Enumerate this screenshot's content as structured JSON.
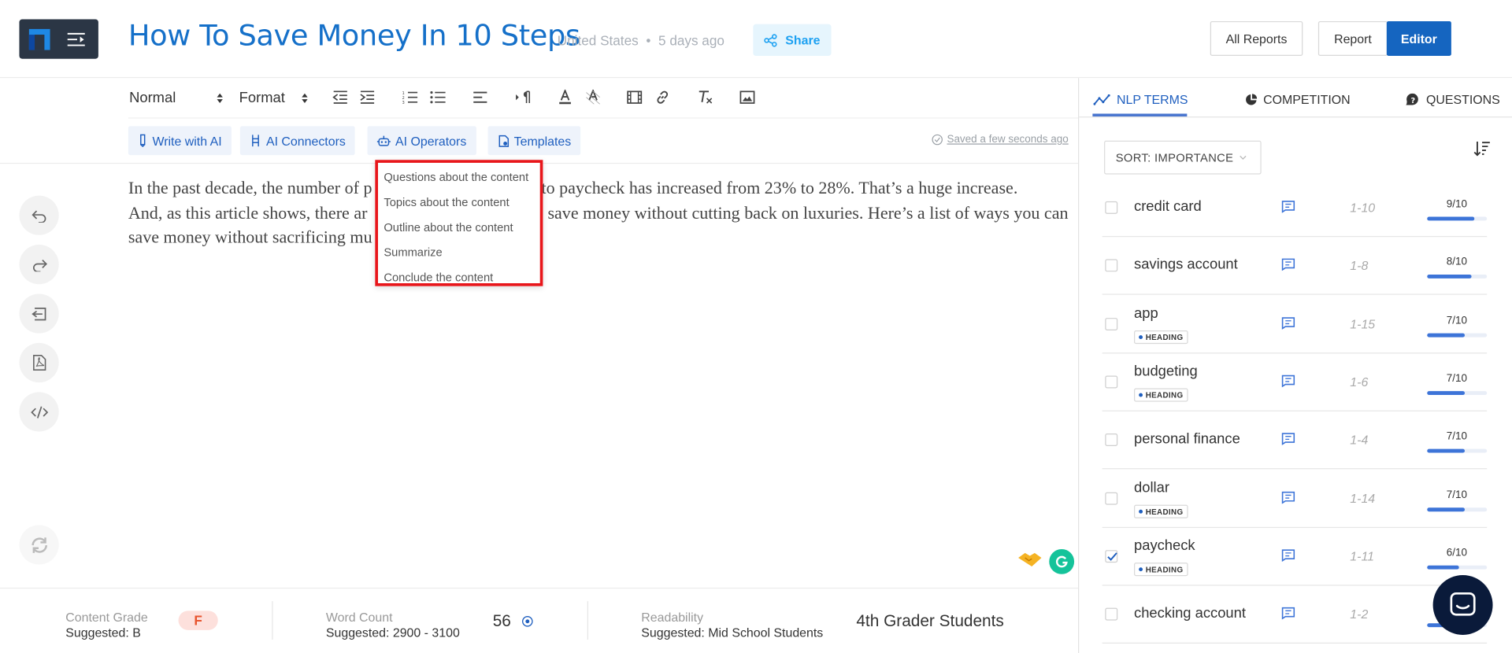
{
  "header": {
    "title": "How To Save Money In 10 Steps",
    "country": "United States",
    "age": "5 days ago",
    "meta_separator": "•",
    "share_label": "Share",
    "all_reports_label": "All Reports",
    "report_label": "Report",
    "editor_label": "Editor"
  },
  "toolbar": {
    "style_select": "Normal",
    "format_select": "Format"
  },
  "ai_bar": {
    "write_with_ai": "Write with AI",
    "ai_connectors": "AI Connectors",
    "ai_operators": "AI Operators",
    "templates": "Templates",
    "saved_status": "Saved a few seconds ago"
  },
  "editor": {
    "line1": "In the past decade, the number of people living paycheck to paycheck has increased from 23% to 28%. That’s a huge increase.",
    "line2": "And, as this article shows, there are many ways you can save money without cutting back on luxuries. Here’s a list of ways you can",
    "line3": "save money without sacrificing much.",
    "l1a": "In the past decade, the number of p",
    "l1b": "k to paycheck has increased from 23% to 28%. That’s a huge increase.",
    "l2a": "And, as this article shows, there ar",
    "l2b": "save money without cutting back on luxuries. Here’s a list of ways you can",
    "l3a": "save money without sacrificing mu"
  },
  "ai_operators_menu": [
    {
      "label": "Questions about the content"
    },
    {
      "label": "Topics about the content"
    },
    {
      "label": "Outline about the content"
    },
    {
      "label": "Summarize"
    },
    {
      "label": "Conclude the content"
    }
  ],
  "footer": {
    "content_grade_label": "Content Grade",
    "content_grade_suggested": "Suggested: B",
    "content_grade_value": "F",
    "word_count_label": "Word Count",
    "word_count_suggested": "Suggested: 2900 - 3100",
    "word_count_value": "56",
    "readability_label": "Readability",
    "readability_suggested": "Suggested: Mid School Students",
    "readability_value": "4th Grader Students"
  },
  "panel": {
    "tabs": [
      "NLP TERMS",
      "COMPETITION",
      "QUESTIONS"
    ],
    "sort_label": "SORT: IMPORTANCE",
    "heading_badge": "HEADING",
    "terms": [
      {
        "term": "credit card",
        "range": "1-10",
        "score": "9/10",
        "score_value": 9,
        "heading": false,
        "checked": false
      },
      {
        "term": "savings account",
        "range": "1-8",
        "score": "8/10",
        "score_value": 8,
        "heading": false,
        "checked": false
      },
      {
        "term": "app",
        "range": "1-15",
        "score": "7/10",
        "score_value": 7,
        "heading": true,
        "checked": false
      },
      {
        "term": "budgeting",
        "range": "1-6",
        "score": "7/10",
        "score_value": 7,
        "heading": true,
        "checked": false
      },
      {
        "term": "personal finance",
        "range": "1-4",
        "score": "7/10",
        "score_value": 7,
        "heading": false,
        "checked": false
      },
      {
        "term": "dollar",
        "range": "1-14",
        "score": "7/10",
        "score_value": 7,
        "heading": true,
        "checked": false
      },
      {
        "term": "paycheck",
        "range": "1-11",
        "score": "6/10",
        "score_value": 6,
        "heading": true,
        "checked": true
      },
      {
        "term": "checking account",
        "range": "1-2",
        "score": "",
        "score_value": 6,
        "heading": false,
        "checked": false
      }
    ]
  },
  "colors": {
    "brand_blue": "#1565c0",
    "title_blue": "#1570c9",
    "highlight_red": "#e8161b",
    "grade_badge_bg": "#fde0dc",
    "grade_badge_text": "#e8542e"
  }
}
